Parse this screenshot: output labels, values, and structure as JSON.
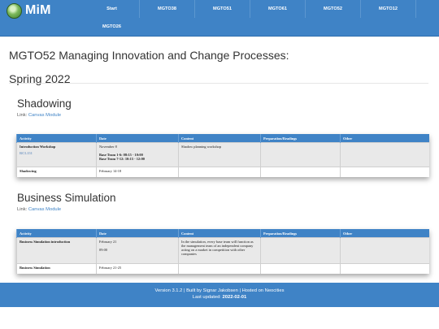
{
  "brand": {
    "name": "MiM"
  },
  "nav": {
    "items": [
      "Start",
      "MGTO38",
      "MGTO51",
      "MGTO61",
      "MGTO52",
      "MGTO12"
    ],
    "second_row": "MGTO26"
  },
  "page": {
    "title_line1": "MGTO52 Managing Innovation and Change Processes:",
    "title_line2": "Spring 2022"
  },
  "sections": [
    {
      "heading": "Shadowing",
      "link_prefix": "Link:",
      "link_text": "Canvas Module",
      "headers": [
        "Activity",
        "Date",
        "Content",
        "Preparation/Readings",
        "Other"
      ],
      "rows": [
        {
          "activity": "Introduction Workshop",
          "activity_extra": "RCL151",
          "date": "November 8",
          "date_line2": "Base Team 1-6: 08:15 - 10:00",
          "date_line3": "Base Team 7-12: 10:15 - 12:00",
          "content": "Shadow planning workshop",
          "prep": "",
          "other": ""
        },
        {
          "activity": "Shadowing",
          "date": "February 14-18",
          "content": "",
          "prep": "",
          "other": ""
        }
      ]
    },
    {
      "heading": "Business Simulation",
      "link_prefix": "Link:",
      "link_text": "Canvas Module",
      "headers": [
        "Activity",
        "Date",
        "Content",
        "Preparation/Readings",
        "Other"
      ],
      "rows": [
        {
          "activity": "Business Simulation introduction",
          "date": "February 21",
          "date_line2": "09:00",
          "content": "In the simulation, every base team will function as the management team of an independent company acting on a market in competition with other companies",
          "prep": "",
          "other": ""
        },
        {
          "activity": "Business Simulation",
          "date": "February 21-25",
          "content": "",
          "prep": "",
          "other": ""
        }
      ]
    }
  ],
  "footer": {
    "line1": "Version 3.1.2 | Built by Signar Jakobsen | Hosted on Neocities",
    "updated_label": "Last updated:",
    "updated_value": "2022-02-01"
  }
}
